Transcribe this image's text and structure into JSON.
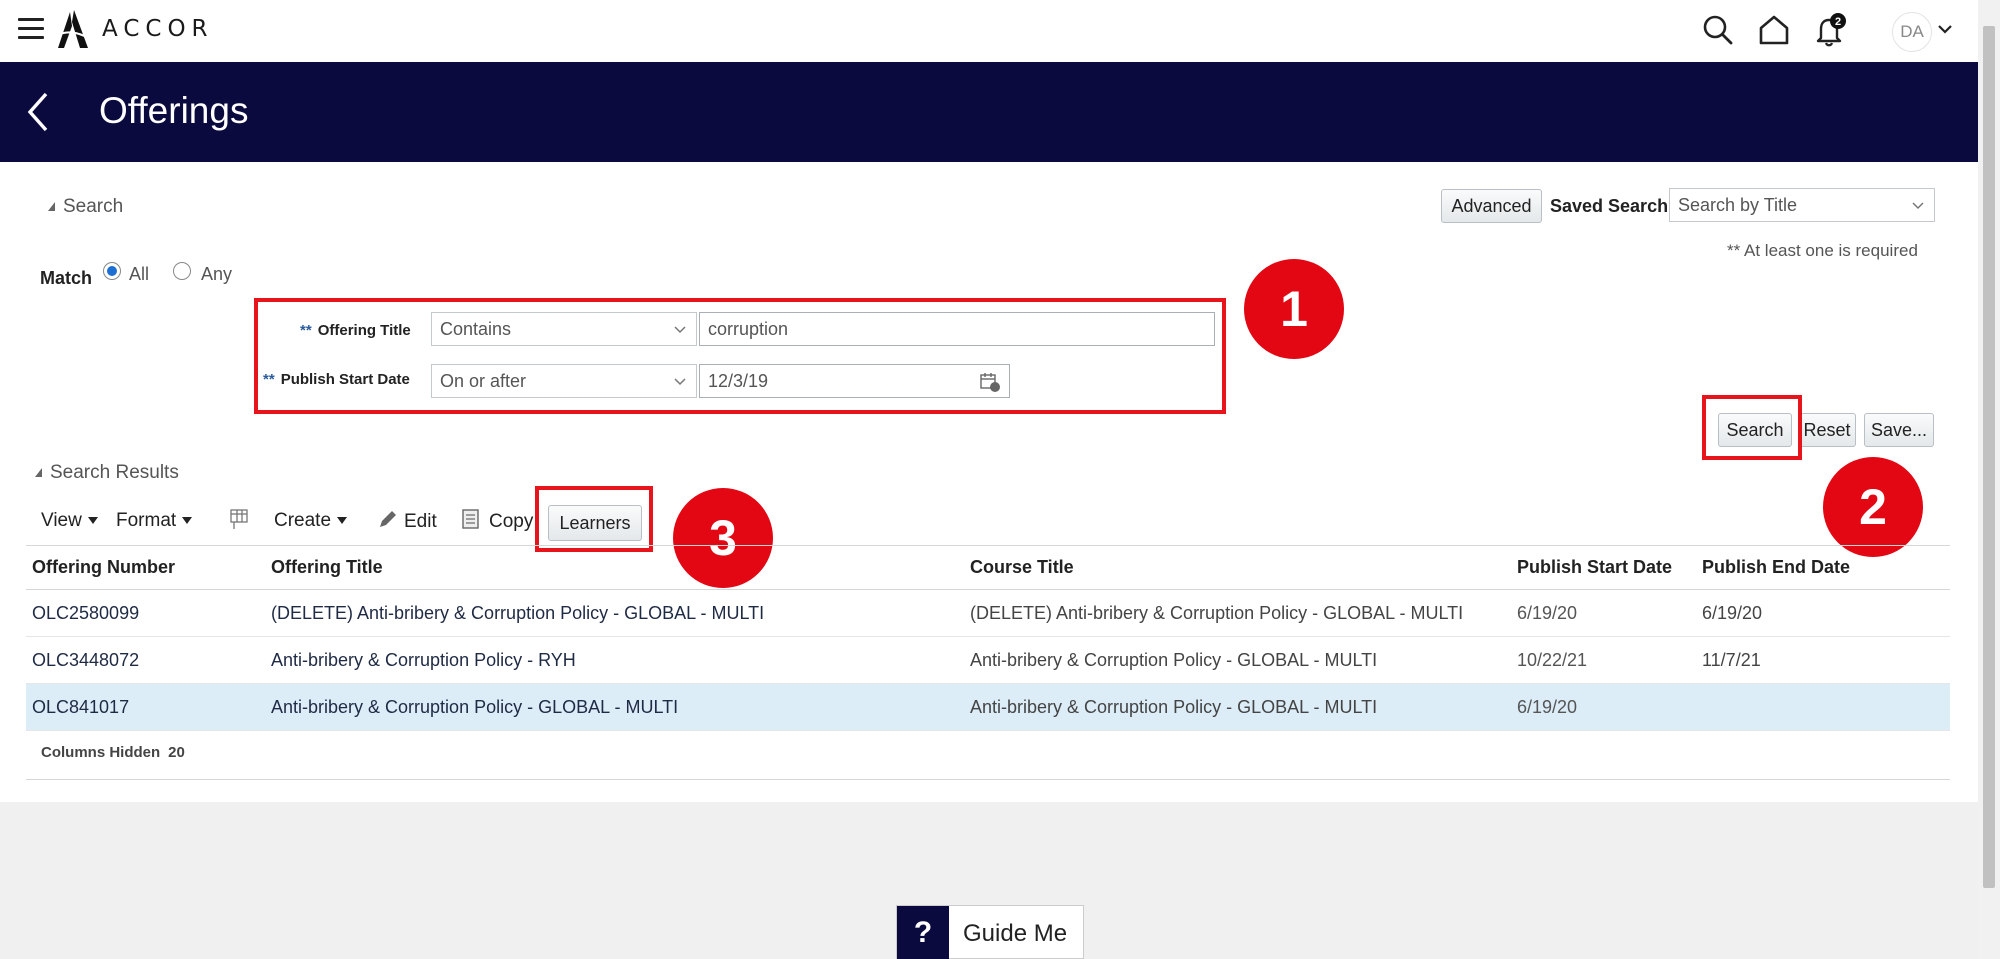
{
  "app": {
    "brand": "ACCOR",
    "notification_count": "2",
    "avatar_initials": "DA"
  },
  "header": {
    "title": "Offerings"
  },
  "search": {
    "section_label": "Search",
    "advanced_label": "Advanced",
    "saved_search_label": "Saved Search",
    "saved_search_placeholder": "Search by Title",
    "required_note": "** At least one is required",
    "match_label": "Match",
    "match_all": "All",
    "match_any": "Any",
    "match_selected": "All",
    "req_marker": "**",
    "fields": [
      {
        "label": "Offering Title",
        "operator": "Contains",
        "value": "corruption"
      },
      {
        "label": "Publish Start Date",
        "operator": "On or after",
        "value": "12/3/19"
      }
    ],
    "buttons": {
      "search": "Search",
      "reset": "Reset",
      "save": "Save..."
    }
  },
  "results": {
    "section_label": "Search Results",
    "toolbar": {
      "view": "View",
      "format": "Format",
      "create": "Create",
      "edit": "Edit",
      "copy": "Copy",
      "learners": "Learners"
    },
    "columns": [
      "Offering Number",
      "Offering Title",
      "Course Title",
      "Publish Start Date",
      "Publish End Date"
    ],
    "rows": [
      {
        "number": "OLC2580099",
        "title": "(DELETE) Anti-bribery & Corruption Policy - GLOBAL - MULTI",
        "course": "(DELETE) Anti-bribery & Corruption Policy - GLOBAL - MULTI",
        "start": "6/19/20",
        "end": "6/19/20"
      },
      {
        "number": "OLC3448072",
        "title": "Anti-bribery & Corruption Policy - RYH",
        "course": "Anti-bribery & Corruption Policy - GLOBAL - MULTI",
        "start": "10/22/21",
        "end": "11/7/21"
      },
      {
        "number": "OLC841017",
        "title": "Anti-bribery & Corruption Policy - GLOBAL - MULTI",
        "course": "Anti-bribery & Corruption Policy - GLOBAL - MULTI",
        "start": "6/19/20",
        "end": ""
      }
    ],
    "selected_row": 2,
    "columns_hidden_label": "Columns Hidden",
    "columns_hidden_count": "20"
  },
  "callouts": [
    "1",
    "2",
    "3"
  ],
  "guide": {
    "q": "?",
    "label": "Guide Me"
  },
  "colors": {
    "header_bg": "#0b0a3e",
    "highlight_red": "#e8141b",
    "selected_row": "#dcedf8"
  }
}
